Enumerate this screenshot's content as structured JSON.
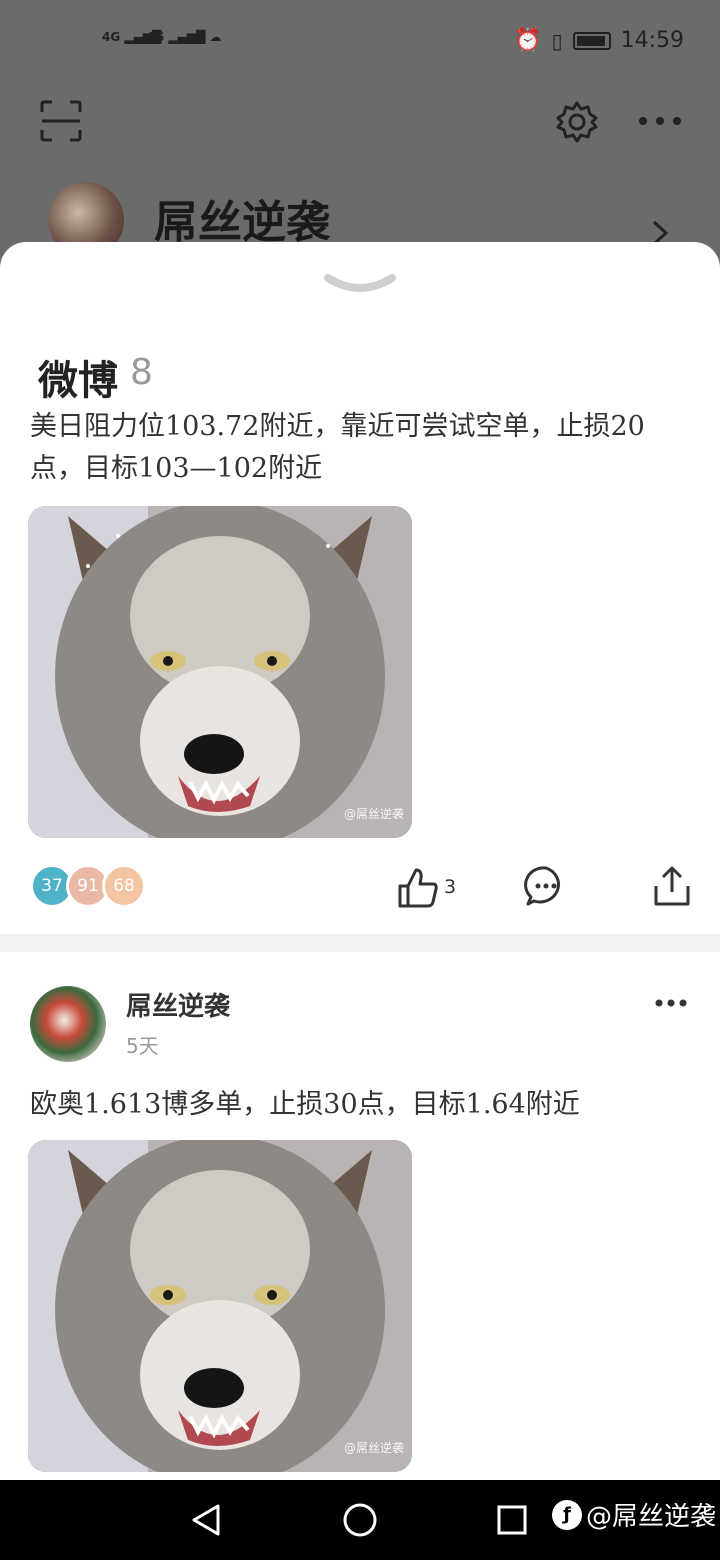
{
  "status_bar": {
    "signal_1": "4G",
    "signal_2": "4G",
    "time": "14:59"
  },
  "background_header": {
    "profile_name": "屌丝逆袭"
  },
  "sheet": {
    "section_title": "微博",
    "section_count": "8",
    "post1": {
      "text": "美日阻力位103.72附近，靠近可尝试空单，止损20点，目标103—102附近",
      "image_watermark": "@屌丝逆袭",
      "reactions": [
        "37",
        "91",
        "68"
      ],
      "like_count": "3"
    },
    "post2": {
      "author": "屌丝逆袭",
      "time": "5天",
      "text": "欧奥1.613博多单，止损30点，目标1.64附近",
      "image_watermark": "@屌丝逆袭"
    }
  },
  "nav": {
    "watermark": "@屌丝逆袭"
  },
  "colors": {
    "accent_blue": "#4fb3c8",
    "reaction_2": "#e9b9a6",
    "reaction_3": "#f3c5a3"
  }
}
